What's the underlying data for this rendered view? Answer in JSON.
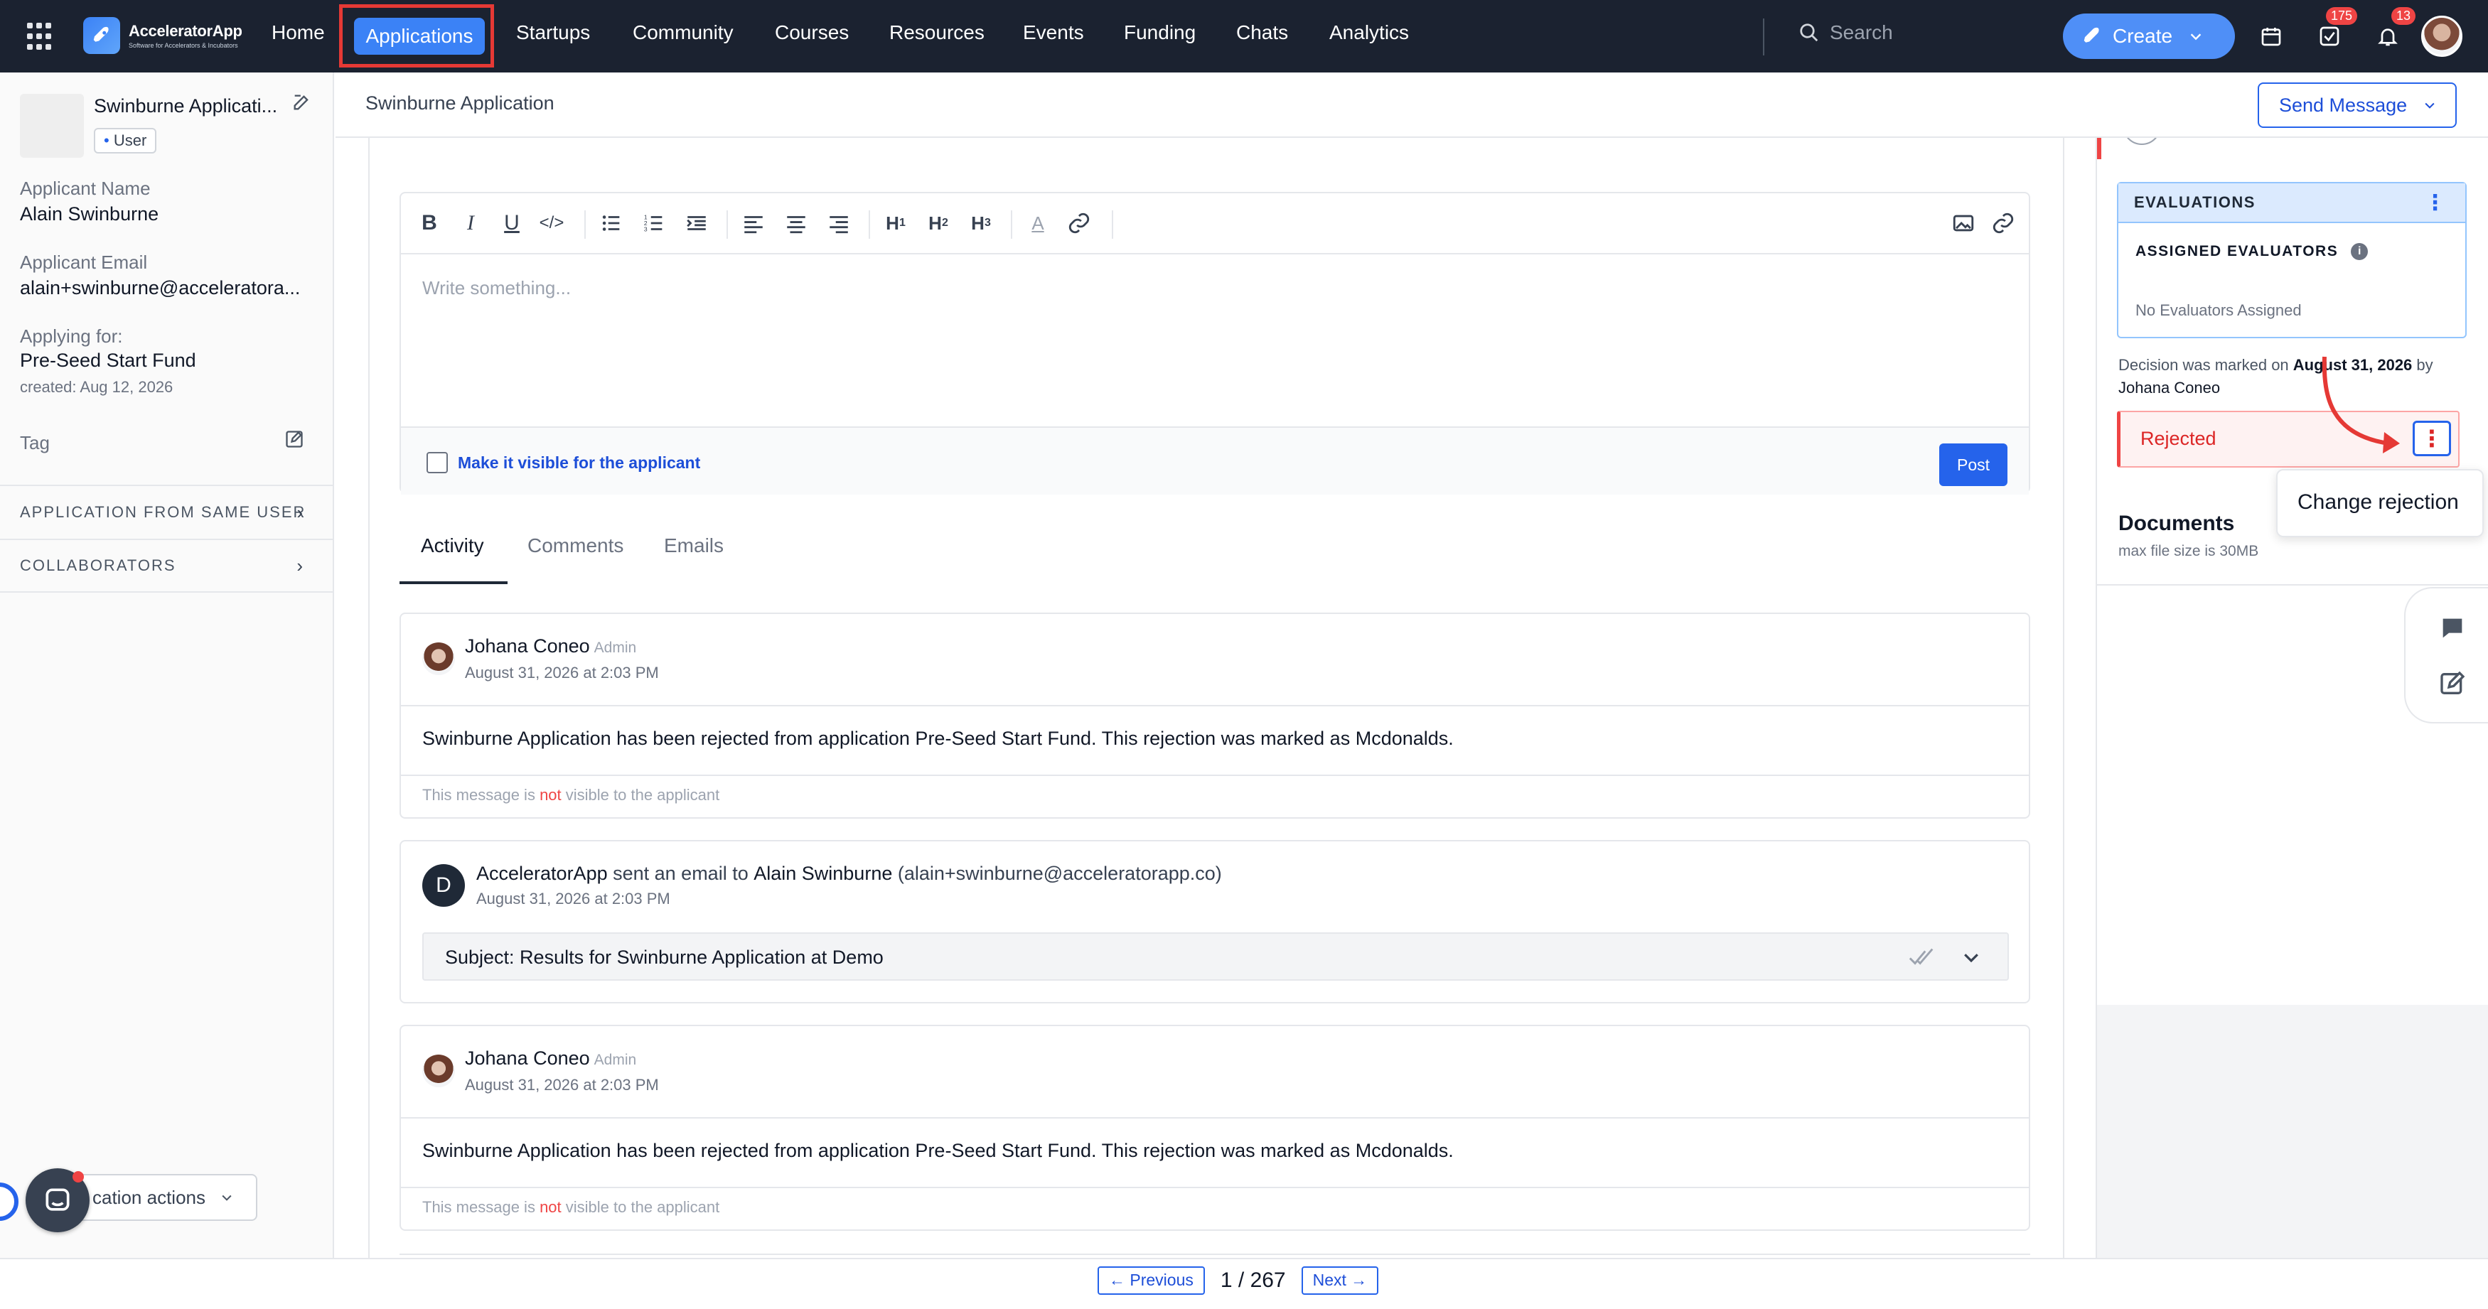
{
  "nav": {
    "brand_name": "AcceleratorApp",
    "brand_tagline": "Software for Accelerators & Incubators",
    "items": [
      "Home",
      "Applications",
      "Startups",
      "Community",
      "Courses",
      "Resources",
      "Events",
      "Funding",
      "Chats",
      "Analytics"
    ],
    "active_item": "Applications",
    "search_placeholder": "Search",
    "create_label": "Create",
    "tasks_badge": "175",
    "notifications_badge": "13"
  },
  "sidebar": {
    "app_title": "Swinburne Applicati...",
    "role_badge": "User",
    "applicant_name_label": "Applicant Name",
    "applicant_name": "Alain Swinburne",
    "applicant_email_label": "Applicant Email",
    "applicant_email": "alain+swinburne@acceleratora...",
    "applying_for_label": "Applying for:",
    "applying_for": "Pre-Seed Start Fund",
    "created": "created: Aug 12, 2026",
    "tag_label": "Tag",
    "section_same_user": "APPLICATION FROM SAME USER",
    "section_collaborators": "COLLABORATORS",
    "actions_label": "cation actions"
  },
  "header": {
    "breadcrumb": "Swinburne Application",
    "send_message": "Send Message"
  },
  "editor": {
    "placeholder": "Write something...",
    "visible_checkbox_label": "Make it visible for the applicant",
    "post_label": "Post",
    "toolbar": [
      "B",
      "I",
      "U",
      "code",
      "bullet-list",
      "numbered-list",
      "indent",
      "align-left",
      "align-center",
      "align-right",
      "H1",
      "H2",
      "H3",
      "text-color",
      "link",
      "image",
      "attachment"
    ]
  },
  "tabs": [
    "Activity",
    "Comments",
    "Emails"
  ],
  "activity": [
    {
      "type": "note",
      "author": "Johana Coneo",
      "role": "Admin",
      "date": "August 31, 2026 at 2:03 PM",
      "body": "Swinburne Application has been rejected from application Pre-Seed Start Fund. This rejection was marked as Mcdonalds.",
      "foot_pre": "This message is ",
      "foot_not": "not",
      "foot_post": " visible to the applicant"
    },
    {
      "type": "email",
      "avatar_letter": "D",
      "sender": "AcceleratorApp",
      "verb": " sent an email to ",
      "recipient": "Alain Swinburne",
      "recipient_email": " (alain+swinburne@acceleratorapp.co)",
      "date": "August 31, 2026 at 2:03 PM",
      "subject": "Subject: Results for Swinburne Application at Demo"
    },
    {
      "type": "note",
      "author": "Johana Coneo",
      "role": "Admin",
      "date": "August 31, 2026 at 2:03 PM",
      "body": "Swinburne Application has been rejected from application Pre-Seed Start Fund. This rejection was marked as Mcdonalds.",
      "foot_pre": "This message is ",
      "foot_not": "not",
      "foot_post": " visible to the applicant"
    }
  ],
  "pager": {
    "prev": "← Previous",
    "count": "1 / 267",
    "next": "Next →"
  },
  "right_panel": {
    "evaluations_title": "EVALUATIONS",
    "assigned_title": "ASSIGNED EVALUATORS",
    "no_evaluators": "No Evaluators Assigned",
    "decision_prefix": "Decision was marked on ",
    "decision_date": "August 31, 2026",
    "decision_by": " by",
    "decision_person": "Johana Coneo",
    "status": "Rejected",
    "menu_item": "Change rejection",
    "documents_title": "Documents",
    "documents_sub": "max file size is 30MB"
  },
  "colors": {
    "nav_bg": "#1b2230",
    "accent": "#2563eb",
    "danger": "#ef4444",
    "highlight_box": "#e53935"
  }
}
